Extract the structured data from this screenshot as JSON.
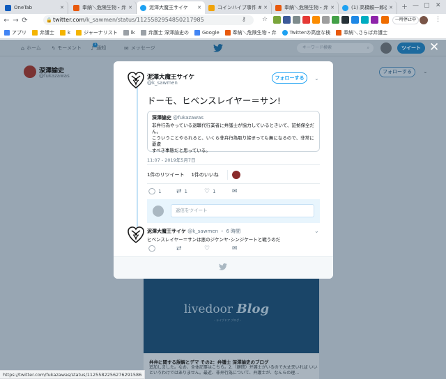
{
  "browser": {
    "tabs": [
      {
        "label": "OneTab",
        "fav": "#0f5bbd"
      },
      {
        "label": "奉納＼危険生物・弁",
        "fav": "#e8590c"
      },
      {
        "label": "泥澤大魔王サイケ",
        "fav": "#1da1f2"
      },
      {
        "label": "コインハイブ事件 #",
        "fav": "#f0a30a"
      },
      {
        "label": "奉納＼危険生物・弁",
        "fav": "#e8590c"
      },
      {
        "label": "(1) 高橋頼一郎@仙",
        "fav": "#1da1f2"
      }
    ],
    "url_host": "twitter.com",
    "url_path": "/k_sawmen/status/1125582954850217985",
    "pause_label": "一時停止中",
    "bookmarks": [
      {
        "label": "アプリ",
        "color": "#4285f4"
      },
      {
        "label": "弁護士",
        "color": "#f4b400"
      },
      {
        "label": "k",
        "color": "#f4b400"
      },
      {
        "label": "ジャーナリスト",
        "color": "#f4b400"
      },
      {
        "label": "lk",
        "color": "#9aa0a6"
      },
      {
        "label": "弁護士 深澤諭史の",
        "color": "#9aa0a6"
      },
      {
        "label": "Google",
        "color": "#4285f4"
      },
      {
        "label": "奉納＼危険生物・弁",
        "color": "#e8590c"
      },
      {
        "label": "Twitterの高度な検",
        "color": "#1da1f2"
      },
      {
        "label": "奉納＼さらば弁護士",
        "color": "#e8590c"
      }
    ],
    "status_url": "https://twitter.com/fukazawas/status/1125582256276291586"
  },
  "twitter_nav": {
    "home": "ホーム",
    "moments": "モーメント",
    "notifications": "通知",
    "notif_count": "1",
    "messages": "メッセージ",
    "search_placeholder": "キーワード検索",
    "tweet_button": "ツイート"
  },
  "profile": {
    "name": "深澤諭史",
    "handle": "@fukazawas",
    "follow_label": "フォローする"
  },
  "background_card": {
    "logo_main": "livedoor",
    "logo_blog": "Blog",
    "logo_sub": "・ライブドア ブログ・",
    "title": "弁弁に関する誤解とデマ その2：弁護士 深澤諭史のブログ",
    "desc": "追加しました。なお、全体記事はこちら。2.（顧問）弁護士がいるので大丈夫いれば いいというわけではありません。最近、非弁行為について、弁護士が、なんらの理…"
  },
  "modal": {
    "author_name": "泥澤大魔王サイケ",
    "author_handle": "@k_sawmen",
    "follow_label": "フォローする",
    "tweet_text": "ドーモ、ヒベンスレイヤー＝サン!",
    "quote": {
      "name": "深澤諭史",
      "handle": "@fukazawas",
      "line1": "非弁行為やっている退職代行業者に弁護士が協力しているときいて、証拠保全だ",
      "line2": "ん。",
      "line3": "こういうことやられると、いくら非弁行為取り締まっても無になるので、非常に憂慮",
      "line4": "すべき事態だと思っている。"
    },
    "date": "11:07 - 2019年5月7日",
    "retweets": "1件のリツイート",
    "likes": "1件のいいね",
    "reply_count": "1",
    "retweet_count": "1",
    "like_count": "1",
    "reply_placeholder": "返信をツイート",
    "reply": {
      "name": "泥澤大魔王サイケ",
      "handle": "@k_sawmen",
      "time": "・ 6 時間",
      "text": "ヒベンスレイヤー＝サンは悪のジケンヤ･シンジケートと戦うのだ"
    }
  }
}
